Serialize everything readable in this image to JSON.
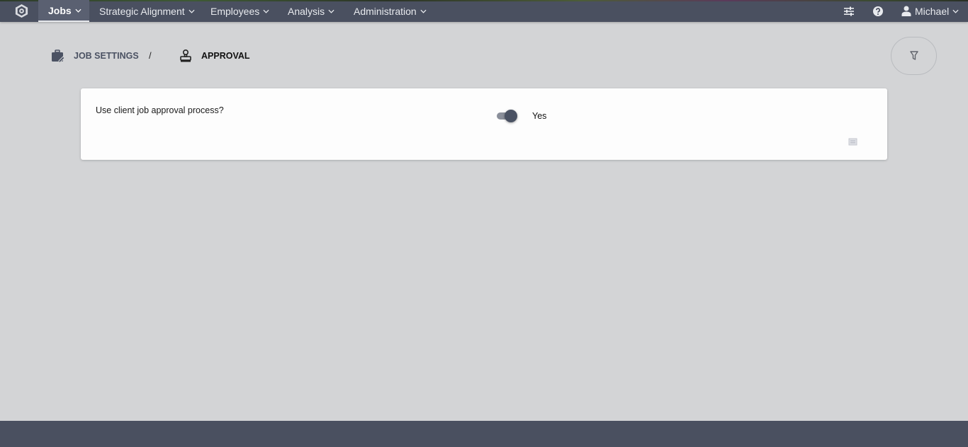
{
  "nav": {
    "items": [
      {
        "label": "Jobs",
        "active": true
      },
      {
        "label": "Strategic Alignment",
        "active": false
      },
      {
        "label": "Employees",
        "active": false
      },
      {
        "label": "Analysis",
        "active": false
      },
      {
        "label": "Administration",
        "active": false
      }
    ],
    "right_icons": [
      "settings-sliders-icon",
      "help-icon"
    ],
    "user": {
      "name": "Michael"
    }
  },
  "breadcrumb": {
    "parent": {
      "label": "JOB SETTINGS",
      "icon": "briefcase-edit-icon"
    },
    "separator": "/",
    "current": {
      "label": "APPROVAL",
      "icon": "stamp-icon"
    }
  },
  "filter": {
    "icon": "filter-icon"
  },
  "setting": {
    "question": "Use client job approval process?",
    "toggle_on": true,
    "toggle_label": "Yes",
    "comment_icon": "comment-icon"
  },
  "colors": {
    "nav_bg": "#4a5060",
    "page_bg": "#d3d4d6",
    "toggle_thumb": "#4a5263"
  }
}
